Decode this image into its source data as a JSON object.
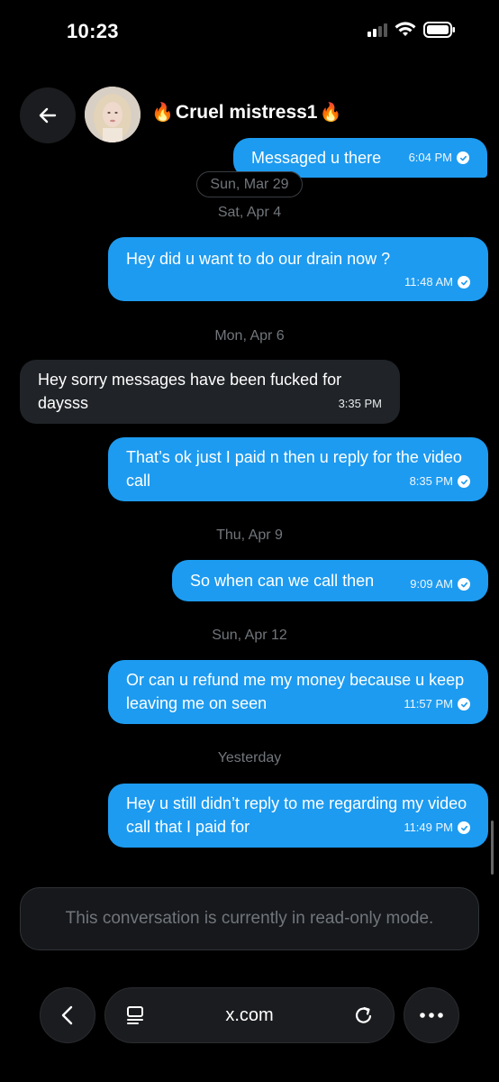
{
  "status_bar": {
    "time": "10:23"
  },
  "header": {
    "contact_name": "Cruel mistress1"
  },
  "messages": [
    {
      "text": "Messaged u there",
      "time": "6:04 PM"
    },
    {
      "text": "Hey did u want to do our drain now ?",
      "time": "11:48 AM"
    },
    {
      "text": "Hey sorry messages have been fucked for daysss",
      "time": "3:35 PM"
    },
    {
      "text": "That’s ok just I paid n then u  reply for the video call",
      "time": "8:35 PM"
    },
    {
      "text": "So when can we call then",
      "time": "9:09 AM"
    },
    {
      "text": "Or can u refund me my money because u keep leaving me on seen",
      "time": "11:57 PM"
    },
    {
      "text": "Hey u still didn’t reply to me regarding my video call that I paid for",
      "time": "11:49 PM"
    }
  ],
  "dates": [
    "Sun, Mar 29",
    "Sat, Apr 4",
    "Mon, Apr 6",
    "Thu, Apr 9",
    "Sun, Apr 12",
    "Yesterday"
  ],
  "composer": {
    "readonly_text": "This conversation is currently in read-only mode."
  },
  "browser": {
    "url": "x.com"
  },
  "colors": {
    "outgoing_bubble": "#1d9bf0",
    "incoming_bubble": "#202327",
    "background": "#000000"
  }
}
